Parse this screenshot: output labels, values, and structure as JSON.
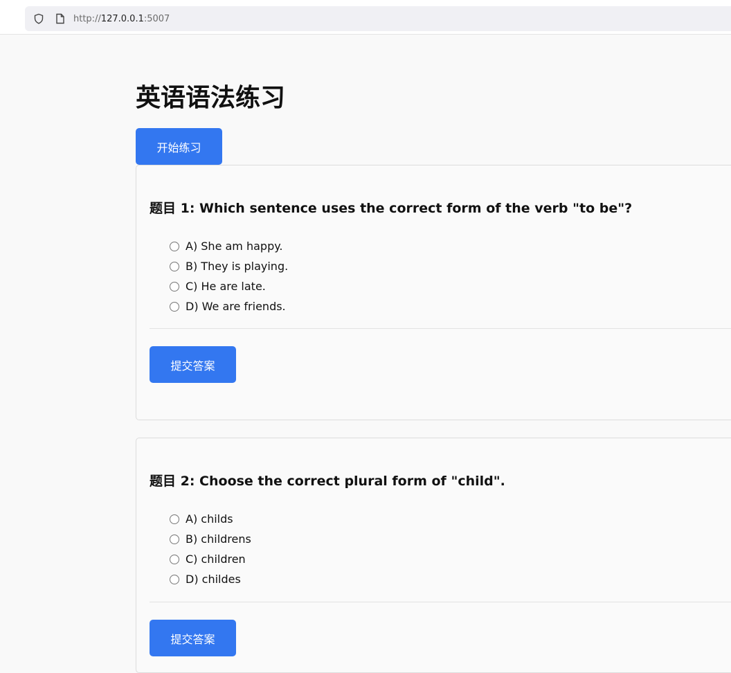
{
  "browser": {
    "url_prefix": "http://",
    "url_host": "127.0.0.1",
    "url_port": ":5007"
  },
  "page": {
    "title": "英语语法练习",
    "start_button": "开始练习"
  },
  "questions": [
    {
      "title": "题目 1: Which sentence uses the correct form of the verb \"to be\"?",
      "options": [
        "A) She am happy.",
        "B) They is playing.",
        "C) He are late.",
        "D) We are friends."
      ],
      "submit_label": "提交答案"
    },
    {
      "title": "题目 2: Choose the correct plural form of \"child\".",
      "options": [
        "A) childs",
        "B) childrens",
        "C) children",
        "D) childes"
      ],
      "submit_label": "提交答案"
    }
  ],
  "colors": {
    "accent": "#3377f0",
    "background": "#f9f9f9"
  }
}
